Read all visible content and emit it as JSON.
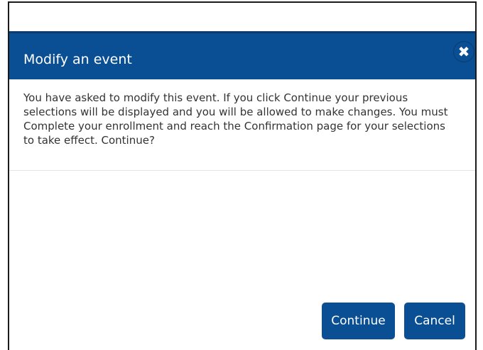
{
  "dialog": {
    "title": "Modify an event",
    "close_icon": "close-icon",
    "message": "You have asked to modify this event. If you click Continue your previous selections will be displayed and you will be allowed to make changes. You must Complete your enrollment and reach the Confirmation page for your selections to take effect. Continue?",
    "continue_label": "Continue",
    "cancel_label": "Cancel"
  },
  "colors": {
    "header": "#0a4f93",
    "button": "#0a4f93",
    "text": "#333333"
  }
}
